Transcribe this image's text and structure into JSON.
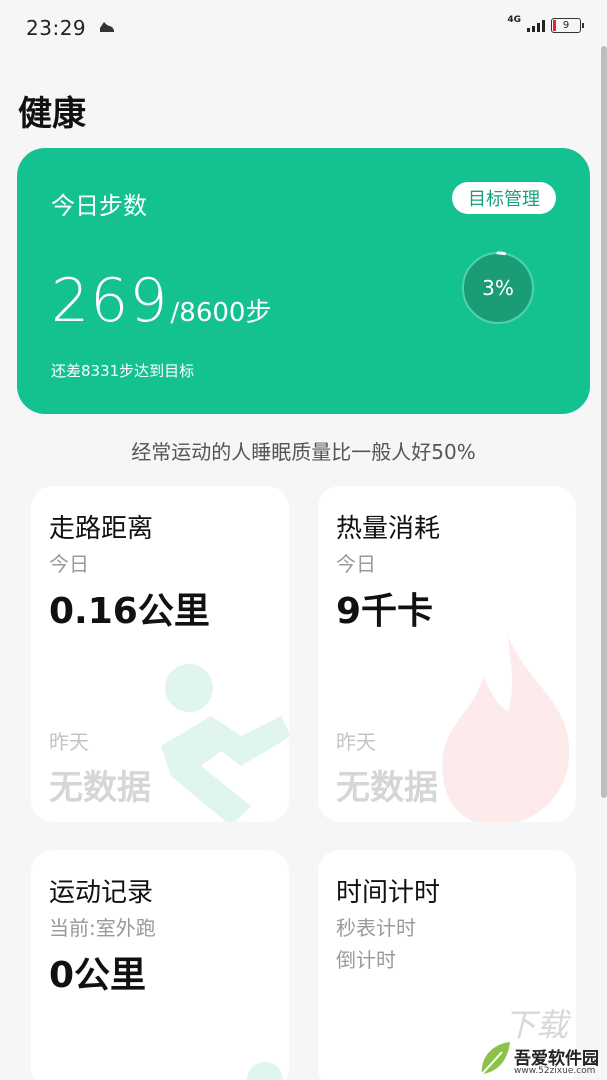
{
  "status_bar": {
    "time": "23:29",
    "network": "4G",
    "battery": "9"
  },
  "page": {
    "title": "健康"
  },
  "steps_card": {
    "title": "今日步数",
    "goal_button": "目标管理",
    "steps": "269",
    "target": "/8600步",
    "progress_label": "3%",
    "progress": 0.03,
    "remaining": "还差8331步达到目标",
    "color": "#14c291"
  },
  "tip": "经常运动的人睡眠质量比一般人好50%",
  "cards": {
    "walk": {
      "title": "走路距离",
      "sub": "今日",
      "value": "0.16公里",
      "yesterday": "昨天",
      "yesterday_value": "无数据",
      "icon": "runner-icon"
    },
    "calories": {
      "title": "热量消耗",
      "sub": "今日",
      "value": "9千卡",
      "yesterday": "昨天",
      "yesterday_value": "无数据",
      "icon": "flame-icon"
    },
    "record": {
      "title": "运动记录",
      "sub": "当前:室外跑",
      "value": "0公里"
    },
    "timer": {
      "title": "时间计时",
      "sub1": "秒表计时",
      "sub2": "倒计时"
    }
  },
  "watermark": {
    "name": "吾爱软件园",
    "url": "www.52zixue.com",
    "top_text": "下载"
  }
}
